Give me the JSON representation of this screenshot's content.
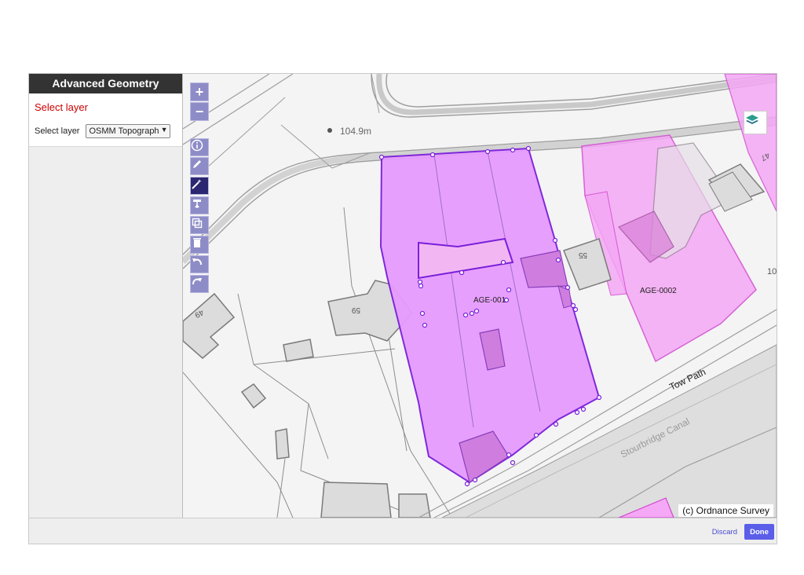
{
  "panel": {
    "title": "Advanced Geometry",
    "heading": "Select layer",
    "select_label": "Select layer",
    "select_value": "OSMM Topographic"
  },
  "map": {
    "spot_height": "104.9m",
    "parcel_labels": [
      "AGE-001",
      "AGE-0002"
    ],
    "house_numbers": [
      "55",
      "59",
      "49",
      "47",
      "10"
    ],
    "road_label": "Tow Path",
    "canal_label": "Stourbridge Canal",
    "attribution": "(c) Ordnance Survey",
    "parcel_fill_selected": "#e79bff",
    "parcel_fill_other": "#f5a8f5",
    "parcel_stroke": "#7a1fd9"
  },
  "toolbar": {
    "zoom_in": "+",
    "zoom_out": "−",
    "tools": [
      "info-icon",
      "edit-icon",
      "magic-wand-icon",
      "split-icon",
      "copy-icon",
      "trash-icon",
      "undo-icon",
      "redo-icon"
    ],
    "active_tool": "magic-wand-icon"
  },
  "footer": {
    "discard_label": "Discard",
    "done_label": "Done"
  }
}
